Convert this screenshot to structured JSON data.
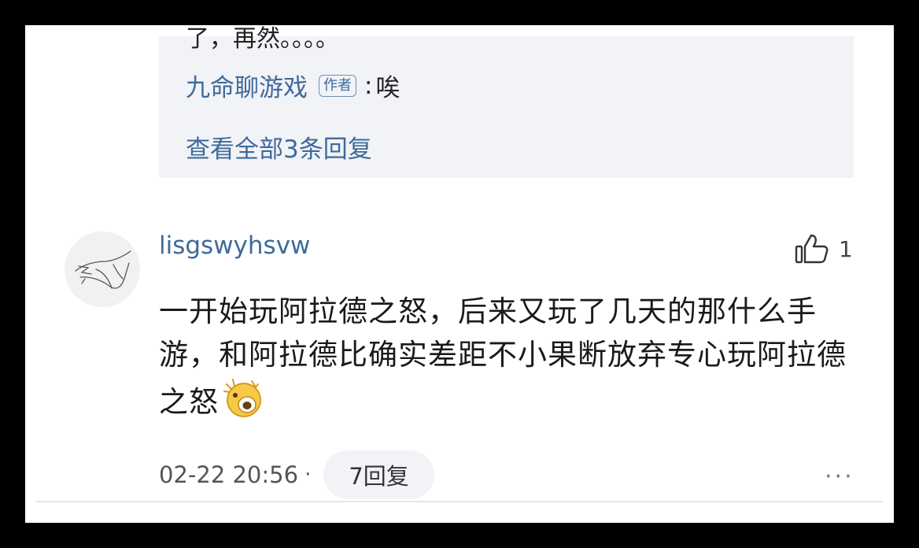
{
  "reply_preview": {
    "clipped_text": "了，再然。。。。",
    "author": "九命聊游戏",
    "author_badge": "作者",
    "separator": ":",
    "text": "唉",
    "view_all": "查看全部3条回复"
  },
  "comment": {
    "username": "lisgswyhsvw",
    "like_count": "1",
    "body": "一开始玩阿拉德之怒，后来又玩了几天的那什么手游，和阿拉德比确实差距不小果断放弃专心玩阿拉德之怒",
    "emoji_icon": "astonished-face-emoji",
    "timestamp": "02-22 20:56",
    "dot": "·",
    "reply_count_label": "7回复",
    "more_label": "···"
  },
  "colors": {
    "link_blue": "#3f6a9a",
    "reply_bg": "#f1f3f7",
    "text": "#1a1a1a"
  }
}
